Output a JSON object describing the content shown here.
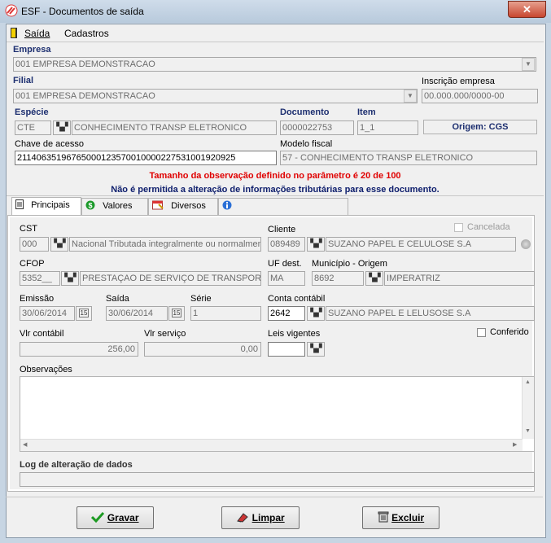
{
  "window": {
    "title": "ESF - Documentos de saída",
    "close_glyph": "✕"
  },
  "menu": {
    "saida": "Saída",
    "cadastros": "Cadastros"
  },
  "header": {
    "empresa_label": "Empresa",
    "empresa_value": "001 EMPRESA DEMONSTRACAO",
    "filial_label": "Filial",
    "filial_value": "001 EMPRESA DEMONSTRACAO",
    "inscricao_label": "Inscrição empresa",
    "inscricao_value": "00.000.000/0000-00",
    "especie_label": "Espécie",
    "especie_code": "CTE",
    "especie_desc": "CONHECIMENTO TRANSP ELETRONICO",
    "documento_label": "Documento",
    "documento_value": "0000022753",
    "item_label": "Item",
    "item_value": "1_1",
    "origem": "Origem: CGS",
    "chave_label": "Chave de acesso",
    "chave_value": "21140635196765000123570010000227531001920925",
    "modelo_label": "Modelo fiscal",
    "modelo_value": "57 - CONHECIMENTO TRANSP ELETRONICO"
  },
  "messages": {
    "line1": "Tamanho da observação definido no parâmetro é 20 de 100",
    "line2": "Não é permitida a alteração de informações tributárias para esse documento.",
    "line1_color": "#e00000",
    "line2_color": "#10206e"
  },
  "tabs": [
    {
      "label": "Principais",
      "icon": "document-icon"
    },
    {
      "label": "Valores",
      "icon": "dollar-icon"
    },
    {
      "label": "Diversos",
      "icon": "calendar-icon"
    },
    {
      "label": "",
      "icon": "info-icon"
    }
  ],
  "principais": {
    "cst_label": "CST",
    "cst_code": "000",
    "cst_desc": "Nacional Tributada integralmente ou normalmente",
    "cliente_label": "Cliente",
    "cliente_code": "089489",
    "cliente_name": "SUZANO PAPEL E CELULOSE S.A",
    "cancelada_label": "Cancelada",
    "cfop_label": "CFOP",
    "cfop_code": "5352__",
    "cfop_desc": "PRESTAÇAO DE SERVIÇO DE TRANSPORT",
    "uf_label": "UF dest.",
    "uf_value": "MA",
    "municipio_label": "Município - Origem",
    "municipio_code": "8692",
    "municipio_name": "IMPERATRIZ",
    "emissao_label": "Emissão",
    "emissao_value": "30/06/2014",
    "saida_label": "Saída",
    "saida_value": "30/06/2014",
    "serie_label": "Série",
    "serie_value": "1",
    "conta_label": "Conta contábil",
    "conta_code": "2642",
    "conta_name": "SUZANO PAPEL E LELUSOSE  S.A",
    "vlr_contabil_label": "Vlr contábil",
    "vlr_contabil_value": "256,00",
    "vlr_servico_label": "Vlr serviço",
    "vlr_servico_value": "0,00",
    "leis_label": "Leis vigentes",
    "leis_value": "",
    "conferido_label": "Conferido",
    "observacoes_label": "Observações",
    "observacoes_value": "",
    "log_label": "Log de alteração de dados",
    "log_value": ""
  },
  "buttons": {
    "gravar": "Gravar",
    "limpar": "Limpar",
    "excluir": "Excluir"
  },
  "icons": {
    "calendar_glyph": "15",
    "dropdown_glyph": "▼",
    "bino_glyph": "🔭"
  }
}
